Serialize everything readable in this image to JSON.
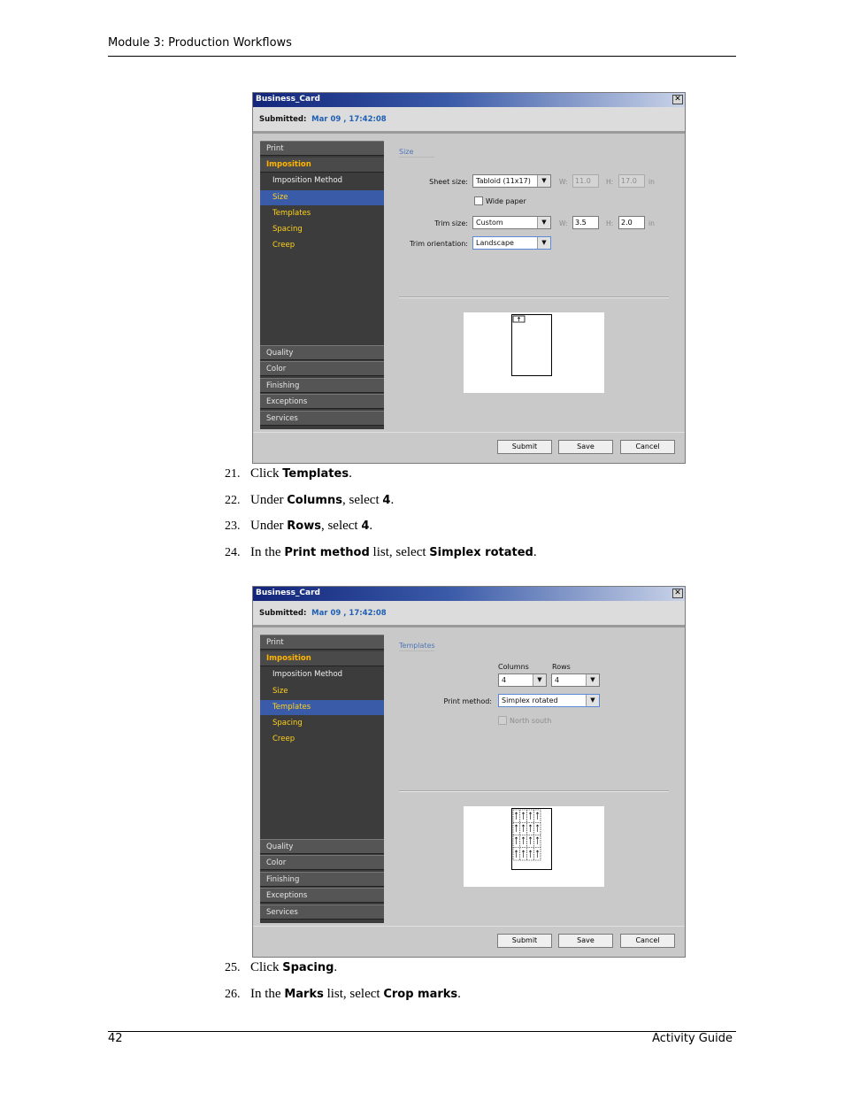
{
  "header": {
    "title": "Module 3: Production Workflows"
  },
  "footer": {
    "page_number": "42",
    "guide": "Activity Guide"
  },
  "dialog": {
    "title": "Business_Card",
    "close_glyph": "✕",
    "submitted_label": "Submitted:",
    "submitted_value": "Mar 09 , 17:42:08",
    "nav": {
      "print": "Print",
      "imposition": "Imposition",
      "imposition_method": "Imposition Method",
      "size": "Size",
      "templates": "Templates",
      "spacing": "Spacing",
      "creep": "Creep",
      "quality": "Quality",
      "color": "Color",
      "finishing": "Finishing",
      "exceptions": "Exceptions",
      "services": "Services"
    },
    "buttons": {
      "submit": "Submit",
      "save": "Save",
      "cancel": "Cancel"
    }
  },
  "dialog1": {
    "section_title": "Size",
    "sheet_size_label": "Sheet size:",
    "sheet_size_value": "Tabloid (11x17)",
    "w_label": "W:",
    "sheet_w": "11.0",
    "h_label": "H:",
    "sheet_h": "17.0",
    "unit": "in",
    "wide_paper": "Wide paper",
    "trim_size_label": "Trim size:",
    "trim_size_value": "Custom",
    "trim_w": "3.5",
    "trim_h": "2.0",
    "trim_orientation_label": "Trim orientation:",
    "trim_orientation_value": "Landscape"
  },
  "dialog2": {
    "section_title": "Templates",
    "columns_label": "Columns",
    "rows_label": "Rows",
    "columns_value": "4",
    "rows_value": "4",
    "print_method_label": "Print method:",
    "print_method_value": "Simplex rotated",
    "north_south": "North south"
  },
  "steps_a": [
    {
      "n": "21.",
      "pre": "Click ",
      "b1": "Templates",
      "mid": ".",
      "b2": "",
      "post": ""
    },
    {
      "n": "22.",
      "pre": "Under ",
      "b1": "Columns",
      "mid": ", select ",
      "b2": "4",
      "post": "."
    },
    {
      "n": "23.",
      "pre": "Under ",
      "b1": "Rows",
      "mid": ", select ",
      "b2": "4",
      "post": "."
    },
    {
      "n": "24.",
      "pre": "In the ",
      "b1": "Print method",
      "mid": " list, select ",
      "b2": "Simplex rotated",
      "post": "."
    }
  ],
  "steps_b": [
    {
      "n": "25.",
      "pre": "Click ",
      "b1": "Spacing",
      "mid": ".",
      "b2": "",
      "post": ""
    },
    {
      "n": "26.",
      "pre": "In the ",
      "b1": "Marks",
      "mid": " list, select ",
      "b2": "Crop marks",
      "post": "."
    }
  ]
}
